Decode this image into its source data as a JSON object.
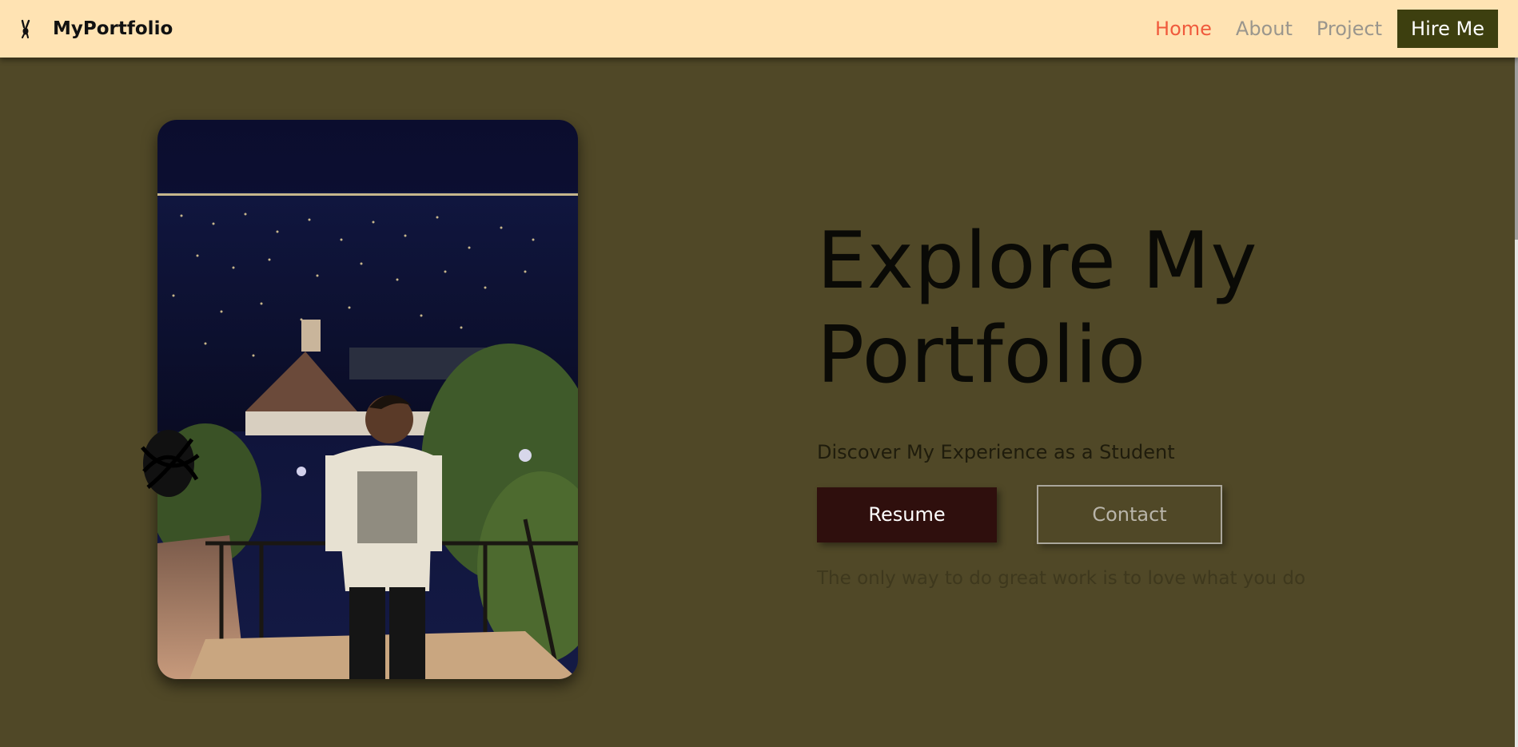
{
  "brand": {
    "icon": "bunny-logo-icon",
    "name": "MyPortfolio"
  },
  "nav": {
    "links": [
      {
        "label": "Home",
        "active": true
      },
      {
        "label": "About",
        "active": false
      },
      {
        "label": "Project",
        "active": false
      }
    ],
    "hire_label": "Hire Me"
  },
  "hero": {
    "title": "Explore My Portfolio",
    "subtitle": "Discover My Experience as a Student",
    "resume_label": "Resume",
    "contact_label": "Contact",
    "quote": "The only way to do great work is to love what you do"
  },
  "colors": {
    "navbar_bg": "#ffe3b3",
    "page_bg": "#504827",
    "active_link": "#f05a3c",
    "hire_button": "#3d3f0f",
    "resume_button": "#2f0f0d"
  },
  "photo": {
    "description_icon": "profile-photo"
  }
}
